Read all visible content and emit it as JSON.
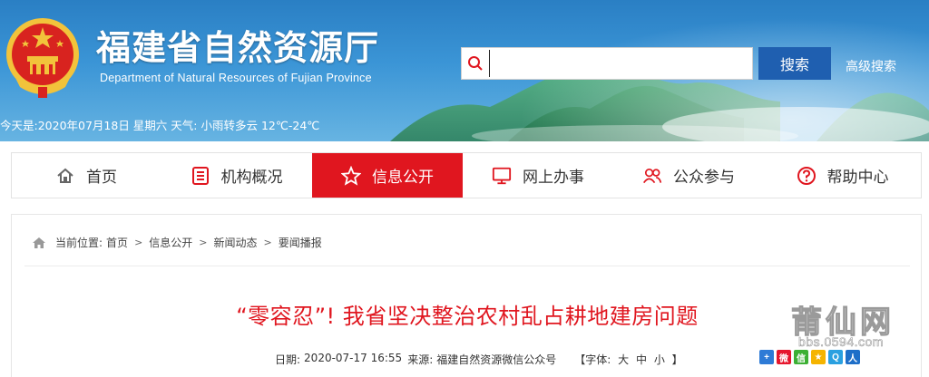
{
  "header": {
    "title": "福建省自然资源厅",
    "subtitle": "Department of Natural Resources of Fujian Province",
    "weather": "今天是:2020年07月18日  星期六  天气: 小雨转多云 12℃-24℃"
  },
  "search": {
    "value": "",
    "button_label": "搜索",
    "advanced_label": "高级搜索"
  },
  "nav": {
    "items": [
      {
        "label": "首页",
        "icon": "home-icon"
      },
      {
        "label": "机构概况",
        "icon": "document-list-icon"
      },
      {
        "label": "信息公开",
        "icon": "star-icon",
        "active": true
      },
      {
        "label": "网上办事",
        "icon": "monitor-icon"
      },
      {
        "label": "公众参与",
        "icon": "users-icon"
      },
      {
        "label": "帮助中心",
        "icon": "help-icon"
      }
    ]
  },
  "breadcrumb": {
    "prefix": "当前位置:",
    "items": [
      "首页",
      "信息公开",
      "新闻动态",
      "要闻播报"
    ]
  },
  "article": {
    "title": "“零容忍”! 我省坚决整治农村乱占耕地建房问题",
    "date_label": "日期:",
    "date": "2020-07-17 16:55",
    "source_label": "来源:",
    "source": "福建自然资源微信公众号",
    "font_label": "【字体:",
    "font_large": "大",
    "font_medium": "中",
    "font_small": "小",
    "font_close": "】"
  },
  "share": {
    "icons": [
      "share-plus-icon",
      "weibo-icon",
      "wechat-icon",
      "qzone-icon",
      "qq-icon",
      "renren-icon"
    ]
  },
  "watermark": {
    "name": "莆仙网",
    "url": "bbs.0594.com"
  },
  "colors": {
    "accent_red": "#e0161f",
    "search_blue": "#1f5fb0",
    "banner_blue": "#3b95d6"
  }
}
